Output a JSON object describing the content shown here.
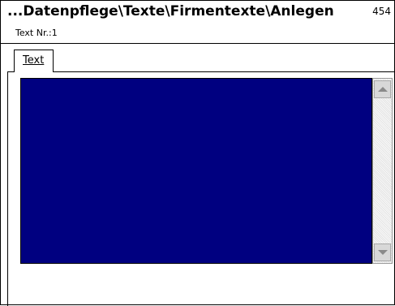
{
  "header": {
    "title": "...Datenpflege\\Texte\\Firmentexte\\Anlegen",
    "subtitle": "Text Nr.:1",
    "counter": "454"
  },
  "tabs": [
    {
      "label": "Text",
      "active": true
    }
  ],
  "editor": {
    "value": "",
    "background": "#000080"
  },
  "scrollbar": {
    "up_icon": "arrow-up-icon",
    "down_icon": "arrow-down-icon"
  }
}
